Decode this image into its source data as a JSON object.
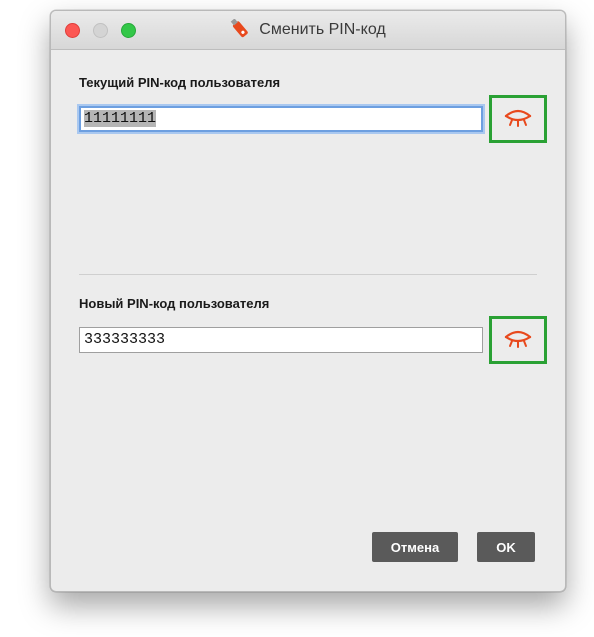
{
  "window": {
    "title": "Сменить PIN-код",
    "title_icon": "usb-token-icon"
  },
  "current_pin": {
    "label": "Текущий PIN-код пользователя",
    "value": "11111111",
    "toggle_icon": "eye-closed-icon"
  },
  "new_pin": {
    "label": "Новый PIN-код пользователя",
    "value": "333333333",
    "toggle_icon": "eye-closed-icon"
  },
  "buttons": {
    "cancel_label": "Отмена",
    "ok_label": "OK"
  },
  "colors": {
    "accent_icon": "#e8491d",
    "highlight_frame": "#2aa134",
    "button_bg": "#5a5a5a",
    "focus_ring": "#6d9fe0"
  }
}
